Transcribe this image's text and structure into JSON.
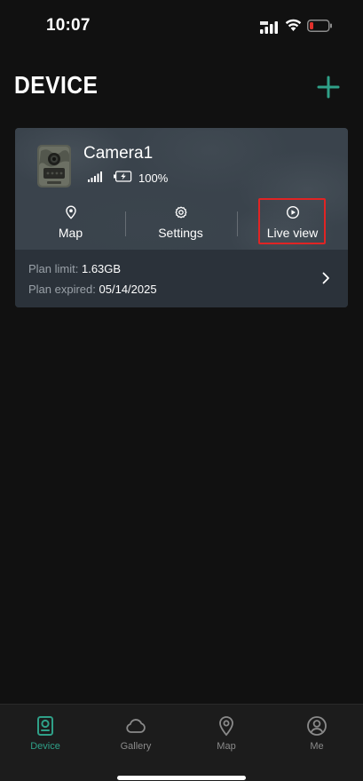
{
  "status_bar": {
    "time": "10:07"
  },
  "header": {
    "title": "DEVICE",
    "add_icon": "plus-icon",
    "accent_color": "#2fa088"
  },
  "device_card": {
    "name": "Camera1",
    "battery_level": "100%",
    "actions": [
      {
        "label": "Map",
        "icon": "location-pin-icon"
      },
      {
        "label": "Settings",
        "icon": "gear-icon"
      },
      {
        "label": "Live view",
        "icon": "play-circle-icon"
      }
    ],
    "highlight_color": "#e02424",
    "plan": {
      "limit_label": "Plan limit:",
      "limit_value": "1.63GB",
      "expired_label": "Plan expired:",
      "expired_value": "05/14/2025"
    }
  },
  "tab_bar": {
    "tabs": [
      {
        "label": "Device",
        "icon": "device-icon",
        "active": true
      },
      {
        "label": "Gallery",
        "icon": "cloud-icon",
        "active": false
      },
      {
        "label": "Map",
        "icon": "location-pin-icon",
        "active": false
      },
      {
        "label": "Me",
        "icon": "user-icon",
        "active": false
      }
    ]
  }
}
